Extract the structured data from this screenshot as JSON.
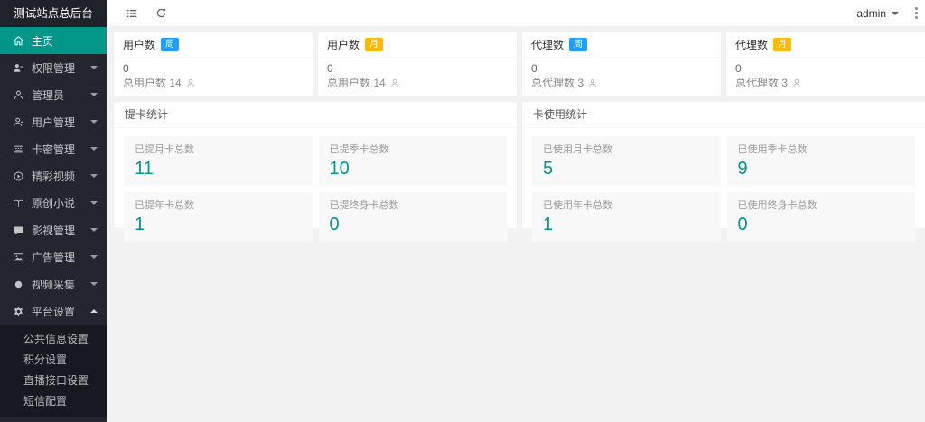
{
  "app": {
    "title": "测试站点总后台"
  },
  "topbar": {
    "admin_label": "admin"
  },
  "sidebar": {
    "items": [
      {
        "label": "主页",
        "active": true
      },
      {
        "label": "权限管理"
      },
      {
        "label": "管理员"
      },
      {
        "label": "用户管理"
      },
      {
        "label": "卡密管理"
      },
      {
        "label": "精彩视频"
      },
      {
        "label": "原创小说"
      },
      {
        "label": "影视管理"
      },
      {
        "label": "广告管理"
      },
      {
        "label": "视频采集"
      },
      {
        "label": "平台设置",
        "expanded": true
      }
    ],
    "submenu": [
      {
        "label": "公共信息设置"
      },
      {
        "label": "积分设置"
      },
      {
        "label": "直播接口设置"
      },
      {
        "label": "短信配置"
      }
    ]
  },
  "stat_cards": [
    {
      "title": "用户数",
      "badge": "周",
      "value": "0",
      "total": "总用户数 14"
    },
    {
      "title": "用户数",
      "badge": "月",
      "value": "0",
      "total": "总用户数 14"
    },
    {
      "title": "代理数",
      "badge": "周",
      "value": "0",
      "total": "总代理数 3"
    },
    {
      "title": "代理数",
      "badge": "月",
      "value": "0",
      "total": "总代理数 3"
    }
  ],
  "panels": [
    {
      "title": "提卡统计",
      "cells": [
        {
          "label": "已提月卡总数",
          "value": "11"
        },
        {
          "label": "已提季卡总数",
          "value": "10"
        },
        {
          "label": "已提年卡总数",
          "value": "1"
        },
        {
          "label": "已提终身卡总数",
          "value": "0"
        }
      ]
    },
    {
      "title": "卡使用统计",
      "cells": [
        {
          "label": "已使用月卡总数",
          "value": "5"
        },
        {
          "label": "已使用季卡总数",
          "value": "9"
        },
        {
          "label": "已使用年卡总数",
          "value": "1"
        },
        {
          "label": "已使用终身卡总数",
          "value": "0"
        }
      ]
    }
  ],
  "colors": {
    "accent": "#009688",
    "badge_week": "#1E9FFF",
    "badge_month": "#FFB800",
    "sidebar_bg": "#23262E",
    "submenu_bg": "#171920",
    "content_bg": "#F2F2F2"
  }
}
